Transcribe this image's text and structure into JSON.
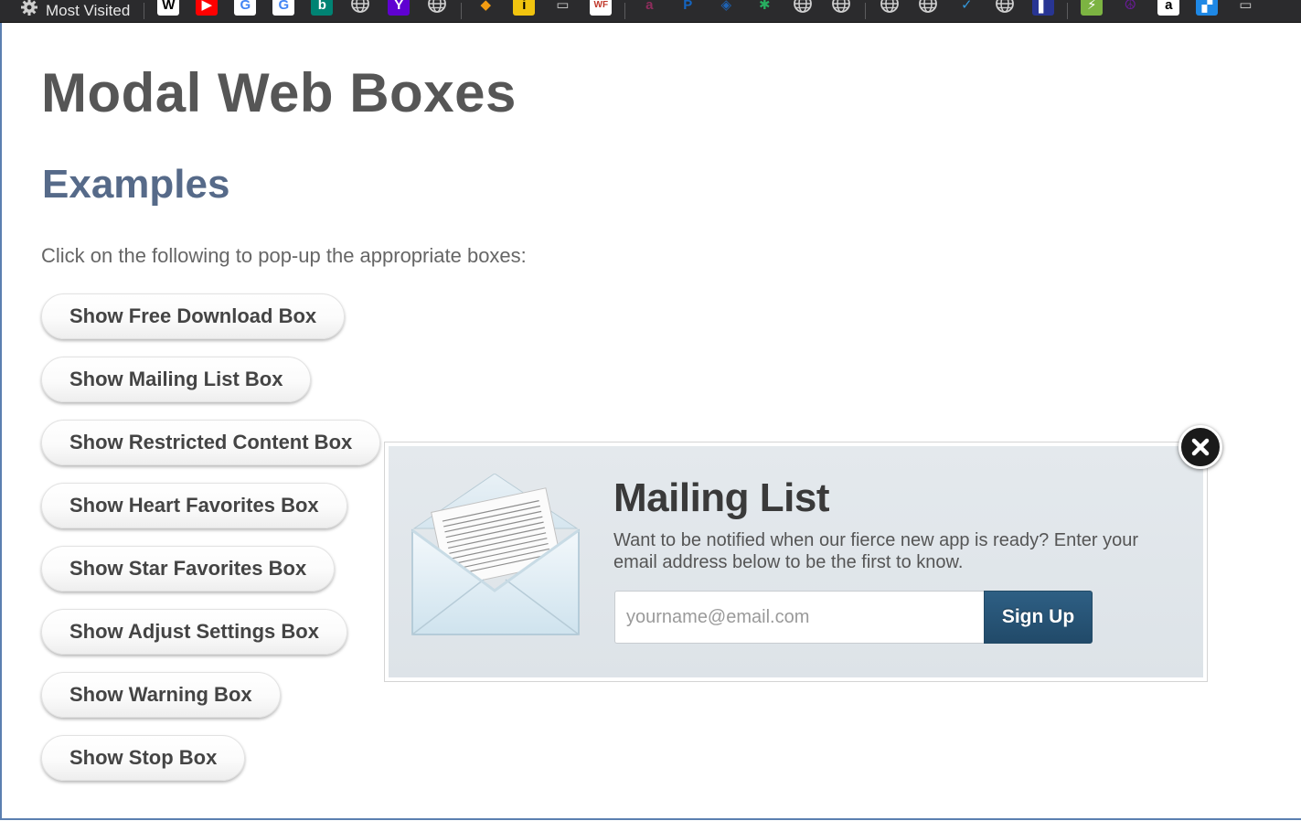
{
  "bookmarks_bar": {
    "most_visited_label": "Most Visited",
    "items": [
      {
        "icon": "wikipedia-icon",
        "glyph": "W",
        "bg": "#ffffff",
        "fg": "#000000"
      },
      {
        "icon": "youtube-icon",
        "glyph": "▶",
        "bg": "#ff0000",
        "fg": "#ffffff"
      },
      {
        "icon": "google-icon",
        "glyph": "G",
        "bg": "#ffffff",
        "fg": "#4285f4"
      },
      {
        "icon": "google-icon",
        "glyph": "G",
        "bg": "#ffffff",
        "fg": "#4285f4"
      },
      {
        "icon": "bing-icon",
        "glyph": "b",
        "bg": "#008373",
        "fg": "#ffffff"
      },
      {
        "icon": "globe-icon",
        "glyph": "",
        "bg": "transparent",
        "fg": "#d0d0d0"
      },
      {
        "icon": "yahoo-icon",
        "glyph": "Y",
        "bg": "#5f01d1",
        "fg": "#ffffff"
      },
      {
        "icon": "globe-icon",
        "glyph": "",
        "bg": "transparent",
        "fg": "#d0d0d0"
      },
      {
        "icon": "diamond-icon",
        "glyph": "◆",
        "bg": "transparent",
        "fg": "#f39c12"
      },
      {
        "icon": "info-icon",
        "glyph": "i",
        "bg": "#f1c40f",
        "fg": "#000000"
      },
      {
        "icon": "window-icon",
        "glyph": "▭",
        "bg": "transparent",
        "fg": "#d0d0d0"
      },
      {
        "icon": "wellsfargo-icon",
        "glyph": "WF",
        "bg": "#ffffff",
        "fg": "#c0392b"
      },
      {
        "icon": "letter-a-icon",
        "glyph": "a",
        "bg": "transparent",
        "fg": "#8e2d5c"
      },
      {
        "icon": "paypal-icon",
        "glyph": "P",
        "bg": "transparent",
        "fg": "#1565c0"
      },
      {
        "icon": "chase-icon",
        "glyph": "◈",
        "bg": "transparent",
        "fg": "#1e63b4"
      },
      {
        "icon": "palm-tree-icon",
        "glyph": "✱",
        "bg": "transparent",
        "fg": "#27ae60"
      },
      {
        "icon": "globe-icon",
        "glyph": "",
        "bg": "transparent",
        "fg": "#d0d0d0"
      },
      {
        "icon": "globe-icon",
        "glyph": "",
        "bg": "transparent",
        "fg": "#d0d0d0"
      },
      {
        "icon": "globe-icon",
        "glyph": "",
        "bg": "transparent",
        "fg": "#d0d0d0"
      },
      {
        "icon": "globe-icon",
        "glyph": "",
        "bg": "transparent",
        "fg": "#d0d0d0"
      },
      {
        "icon": "checkmark-icon",
        "glyph": "✓",
        "bg": "transparent",
        "fg": "#3498db"
      },
      {
        "icon": "globe-icon",
        "glyph": "",
        "bg": "transparent",
        "fg": "#d0d0d0"
      },
      {
        "icon": "bookmark-blue-icon",
        "glyph": "▌",
        "bg": "#283593",
        "fg": "#ffffff"
      },
      {
        "icon": "lightning-icon",
        "glyph": "⚡",
        "bg": "#7cb342",
        "fg": "#ffffff"
      },
      {
        "icon": "peace-icon",
        "glyph": "☮",
        "bg": "transparent",
        "fg": "#6a1b9a"
      },
      {
        "icon": "amazon-icon",
        "glyph": "a",
        "bg": "#ffffff",
        "fg": "#000000"
      },
      {
        "icon": "windows-tile-icon",
        "glyph": "▞",
        "bg": "#1e88e5",
        "fg": "#ffffff"
      },
      {
        "icon": "window-icon",
        "glyph": "▭",
        "bg": "transparent",
        "fg": "#d0d0d0"
      }
    ]
  },
  "page": {
    "title": "Modal Web Boxes",
    "section_title": "Examples",
    "intro": "Click on the following to pop-up the appropriate boxes:",
    "buttons": [
      "Show Free Download Box",
      "Show Mailing List Box",
      "Show Restricted Content Box",
      "Show Heart Favorites Box",
      "Show Star Favorites Box",
      "Show Adjust Settings Box",
      "Show Warning Box",
      "Show Stop Box"
    ]
  },
  "modal": {
    "title": "Mailing List",
    "description": "Want to be notified when our fierce new app is ready? Enter your email address below to be the first to know.",
    "email_placeholder": "yourname@email.com",
    "email_value": "",
    "signup_label": "Sign Up",
    "close_icon": "close-icon"
  },
  "colors": {
    "title": "#565656",
    "section_title": "#566a89",
    "signup_bg": "#27567a",
    "modal_bg": "#e2e7eb",
    "page_frame_border": "#5b7fb0"
  }
}
